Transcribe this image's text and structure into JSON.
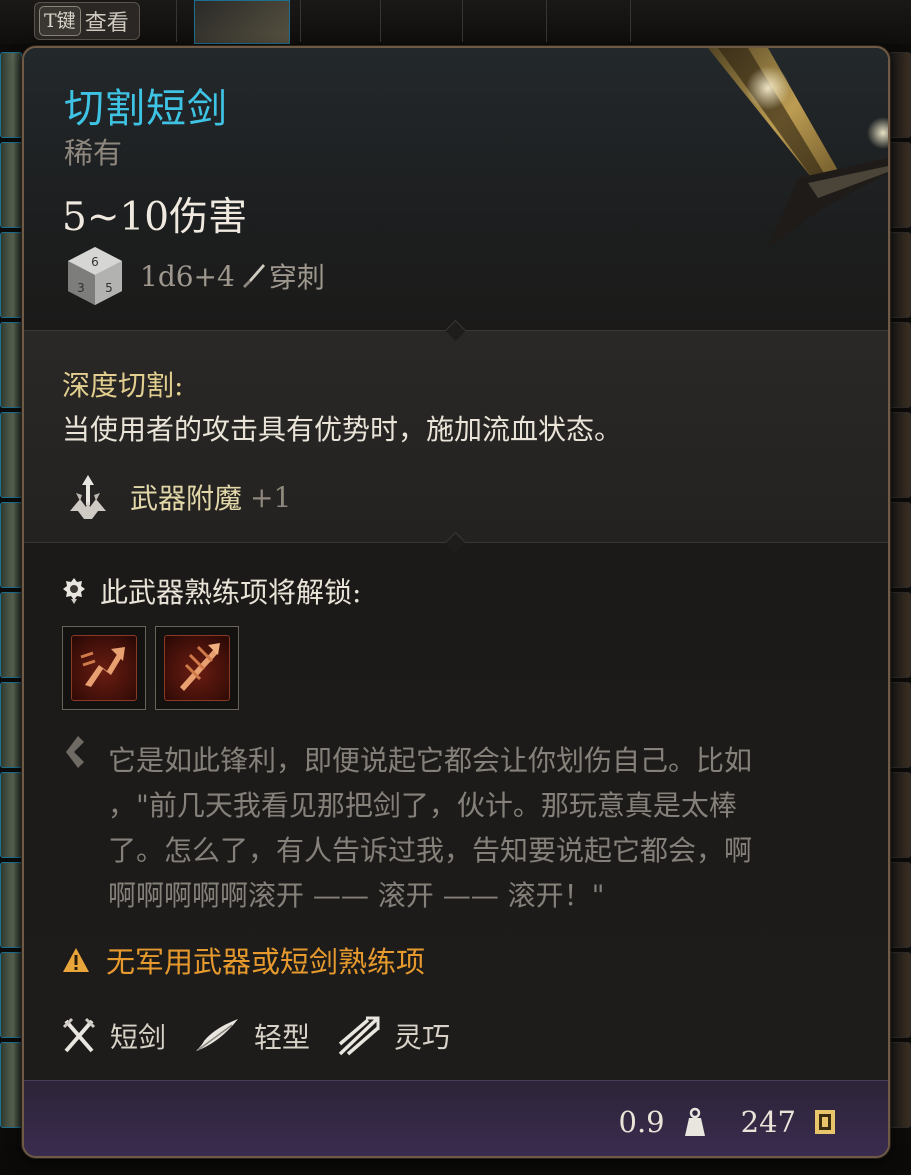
{
  "hint": {
    "key": "T键",
    "label": "查看"
  },
  "item": {
    "name": "切割短剑",
    "rarity": "稀有",
    "damage": "5~10伤害",
    "damage_dice": "1d6+4",
    "damage_type": "穿刺"
  },
  "ability": {
    "title": "深度切割:",
    "description": "当使用者的攻击具有优势时，施加流血状态。"
  },
  "enchantment": {
    "label": "武器附魔",
    "value": "+1"
  },
  "proficiency": {
    "label": "此武器熟练项将解锁:"
  },
  "flavor": {
    "lines": [
      "它是如此锋利，即便说起它都会让你划伤自己。比如",
      "，\"前几天我看见那把剑了，伙计。那玩意真是太棒",
      "了。怎么了，有人告诉过我，告知要说起它都会，啊",
      "啊啊啊啊啊滚开 —— 滚开 —— 滚开！\""
    ]
  },
  "warning": "无军用武器或短剑熟练项",
  "properties": [
    {
      "icon": "crossed-swords-icon",
      "label": "短剑"
    },
    {
      "icon": "feather-icon",
      "label": "轻型"
    },
    {
      "icon": "finesse-icon",
      "label": "灵巧"
    }
  ],
  "footer": {
    "weight": "0.9",
    "price": "247"
  },
  "colors": {
    "title": "#3fc3e4",
    "ability_title": "#e2cf8f",
    "warning": "#e69a2e",
    "footer_bg": "#3a2c4f",
    "border": "#6e5a45"
  }
}
